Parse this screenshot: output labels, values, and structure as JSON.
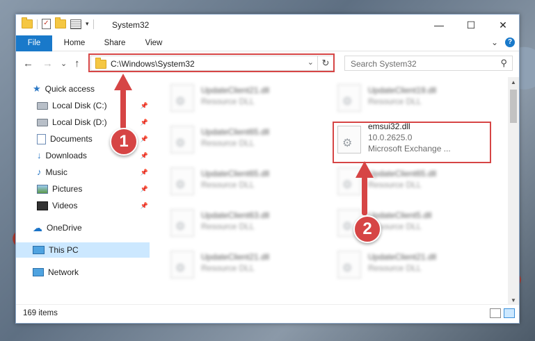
{
  "window": {
    "title": "System32",
    "caption": {
      "minimize": "—",
      "maximize": "☐",
      "close": "✕"
    }
  },
  "ribbon": {
    "tabs": [
      {
        "label": "File",
        "active": true
      },
      {
        "label": "Home"
      },
      {
        "label": "Share"
      },
      {
        "label": "View"
      }
    ],
    "expand_glyph": "⌄",
    "help_glyph": "?"
  },
  "nav": {
    "back": "←",
    "forward": "→",
    "recent": "⌄",
    "up": "↑",
    "address": "C:\\Windows\\System32",
    "address_chevron": "⌄",
    "refresh": "↻",
    "search_placeholder": "Search System32",
    "search_glyph": "⚲"
  },
  "sidebar": {
    "items": [
      {
        "label": "Quick access",
        "icon": "star-icon",
        "pinned": false
      },
      {
        "label": "Local Disk (C:)",
        "icon": "drive-icon",
        "pinned": true
      },
      {
        "label": "Local Disk (D:)",
        "icon": "drive-icon",
        "pinned": true
      },
      {
        "label": "Documents",
        "icon": "documents-icon",
        "pinned": true
      },
      {
        "label": "Downloads",
        "icon": "downloads-icon",
        "pinned": true
      },
      {
        "label": "Music",
        "icon": "music-icon",
        "pinned": true
      },
      {
        "label": "Pictures",
        "icon": "pictures-icon",
        "pinned": true
      },
      {
        "label": "Videos",
        "icon": "videos-icon",
        "pinned": true
      },
      {
        "label": "OneDrive",
        "icon": "onedrive-icon",
        "pinned": false
      },
      {
        "label": "This PC",
        "icon": "this-pc-icon",
        "pinned": false,
        "selected": true
      },
      {
        "label": "Network",
        "icon": "network-icon",
        "pinned": false
      }
    ],
    "pin_glyph": "📌"
  },
  "files": [
    {
      "name": "UpdateClient21.dll",
      "type": "Resource DLL"
    },
    {
      "name": "UpdateClient19.dll",
      "type": "Resource DLL"
    },
    {
      "name": "UpdateClient65.dll",
      "type": "Resource DLL"
    },
    {
      "name": "emsui32.dll",
      "version": "10.0.2625.0",
      "company": "Microsoft Exchange ...",
      "highlighted": true
    },
    {
      "name": "UpdateClient65.dll",
      "type": "Resource DLL"
    },
    {
      "name": "UpdateClient65.dll",
      "type": "Resource DLL"
    },
    {
      "name": "UpdateClient63.dll",
      "type": "Resource DLL"
    },
    {
      "name": "UpdateClient5.dll",
      "type": "Resource DLL"
    },
    {
      "name": "UpdateClient21.dll",
      "type": "Resource DLL"
    },
    {
      "name": "UpdateClient21.dll",
      "type": "Resource DLL"
    }
  ],
  "status": {
    "item_count": "169 items"
  },
  "callouts": [
    {
      "number": "1"
    },
    {
      "number": "2"
    }
  ],
  "colors": {
    "accent": "#1979ca",
    "highlight": "#d64545",
    "selection": "#cce8ff"
  }
}
